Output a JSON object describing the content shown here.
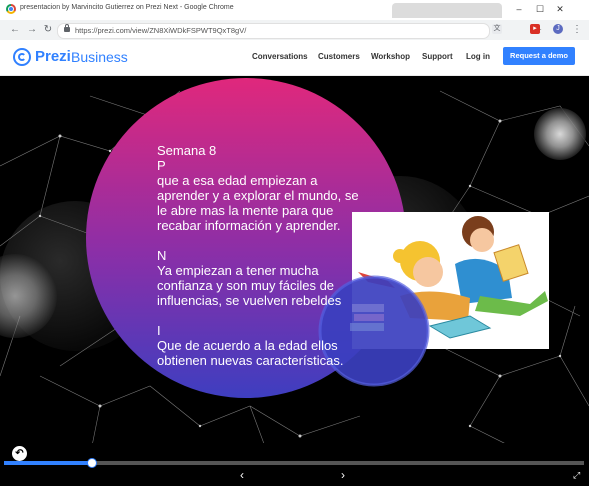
{
  "window": {
    "title": "presentacion by Marvincito Gutierrez on Prezi Next - Google Chrome",
    "minimize_icon": "minimize-icon",
    "maximize_icon": "maximize-icon",
    "close_icon": "close-icon"
  },
  "browser": {
    "url": "https://prezi.com/view/ZN8XiWDkFSPWT9QxT8gV/",
    "back_icon": "arrow-left-icon",
    "forward_icon": "arrow-right-icon",
    "reload_icon": "reload-icon"
  },
  "header": {
    "brand_prezi": "Prezi",
    "brand_business": "Business",
    "nav": [
      "Conversations",
      "Customers",
      "Workshop",
      "Support",
      "Log in"
    ],
    "cta_label": "Request a demo",
    "accent": "#3181ff"
  },
  "slide": {
    "lines": [
      "Semana 8",
      "P",
      "que a esa edad empiezan a aprender y a explorar el mundo, se le abre mas la mente para que recabar información y aprender.",
      "N",
      "Ya empiezan a tener mucha confianza y son muy fáciles de influencias, se vuelven rebeldes",
      "I",
      "Que de acuerdo a la edad ellos obtienen nuevas características."
    ],
    "circle_colors": [
      "#d2277f",
      "#3a3fb8"
    ],
    "image_name": "children-reading-illustration"
  },
  "player": {
    "progress": 0.15,
    "prev_icon": "chevron-left-icon",
    "next_icon": "chevron-right-icon",
    "fullscreen_icon": "fullscreen-icon",
    "back_icon": "back-arrow-icon"
  }
}
